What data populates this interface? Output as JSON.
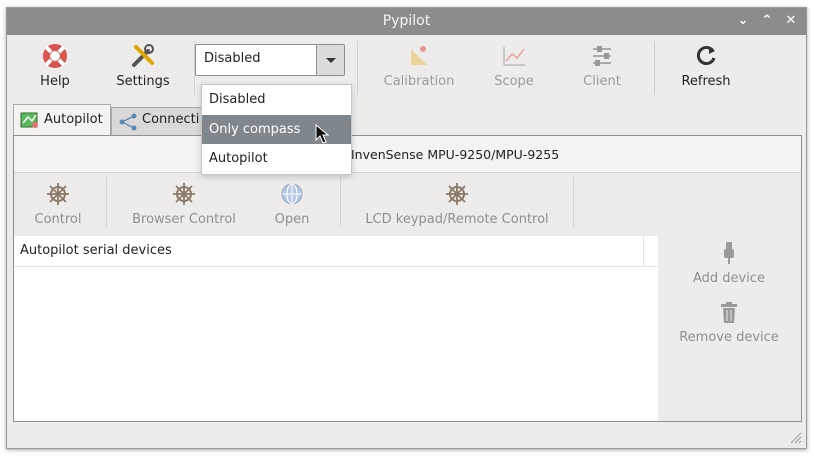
{
  "window": {
    "title": "Pypilot"
  },
  "window_controls": {
    "minimize": "⌄",
    "maximize": "⌃",
    "close": "✕"
  },
  "toolbar": {
    "help_label": "Help",
    "settings_label": "Settings",
    "mode_value": "Disabled",
    "calibration_label": "Calibration",
    "scope_label": "Scope",
    "client_label": "Client",
    "refresh_label": "Refresh"
  },
  "dropdown": {
    "options": [
      "Disabled",
      "Only compass",
      "Autopilot"
    ],
    "highlighted": "Only compass"
  },
  "tabs": [
    "Autopilot",
    "Connecti"
  ],
  "status": {
    "imu_text": "InvenSense MPU-9250/MPU-9255"
  },
  "controls": [
    "Control",
    "Browser Control",
    "Open",
    "LCD keypad/Remote Control"
  ],
  "devices": {
    "header": "Autopilot serial devices",
    "add_label": "Add device",
    "remove_label": "Remove device"
  },
  "colors": {
    "titlebar": "#8c8c8c",
    "highlight": "#7f868c",
    "help_red": "#d9534f"
  }
}
